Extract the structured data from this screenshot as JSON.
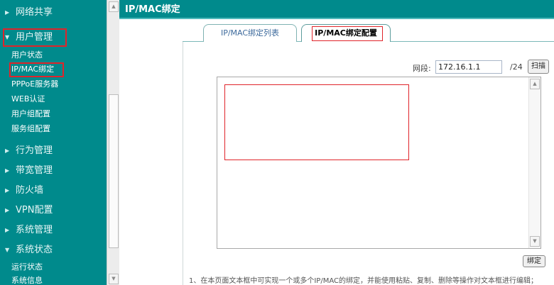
{
  "sidebar": {
    "items": [
      {
        "label": "网络共享",
        "arrow": "▶"
      },
      {
        "label": "用户管理",
        "arrow": "▼"
      },
      {
        "label": "行为管理",
        "arrow": "▶"
      },
      {
        "label": "带宽管理",
        "arrow": "▶"
      },
      {
        "label": "防火墙",
        "arrow": "▶"
      },
      {
        "label": "VPN配置",
        "arrow": "▶"
      },
      {
        "label": "系统管理",
        "arrow": "▶"
      },
      {
        "label": "系统状态",
        "arrow": "▼"
      }
    ],
    "user_mgmt_subitems": [
      "用户状态",
      "IP/MAC绑定",
      "PPPoE服务器",
      "WEB认证",
      "用户组配置",
      "服务组配置"
    ],
    "status_subitems": [
      "运行状态",
      "系统信息"
    ]
  },
  "header": {
    "title": "IP/MAC绑定"
  },
  "tabs": [
    {
      "label": "IP/MAC绑定列表"
    },
    {
      "label": "IP/MAC绑定配置"
    }
  ],
  "segment": {
    "label": "网段:",
    "value": "172.16.1.1",
    "suffix": "/24",
    "scan_label": "扫描"
  },
  "textbox": {
    "content": ""
  },
  "bind_button": {
    "label": "绑定"
  },
  "note": "1、在本页面文本框中可实现一个或多个IP/MAC的绑定，并能使用粘贴、复制、删除等操作对文本框进行编辑；",
  "colors": {
    "sidebar": "#008a8c",
    "highlight": "#e0242a"
  }
}
